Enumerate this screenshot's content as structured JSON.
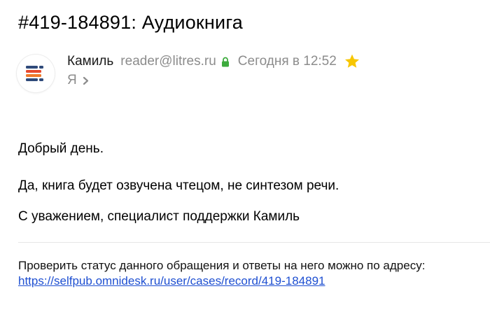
{
  "email": {
    "subject": "#419-184891: Аудиокнига",
    "sender": {
      "name": "Камиль",
      "email": "reader@litres.ru",
      "verified_icon": "lock-icon",
      "date": "Сегодня в 12:52",
      "starred": true,
      "star_icon": "star-icon"
    },
    "recipient": {
      "label": "Я",
      "expand_icon": "chevron-right-icon"
    },
    "avatar": {
      "icon": "selfpub-logo-icon",
      "colors": [
        "#2f4a7a",
        "#e84a2f",
        "#f07a2a"
      ]
    },
    "body": {
      "greeting": "Добрый день.",
      "answer": "Да, книга будет озвучена чтецом, не синтезом речи.",
      "signature": "С уважением, специалист поддержки Камиль"
    },
    "footer": {
      "note": "Проверить статус данного обращения и ответы на него можно по адресу:",
      "link_text": "https://selfpub.omnidesk.ru/user/cases/record/419-184891"
    }
  },
  "colors": {
    "link": "#1e4fd1",
    "secondary_text": "#8c8c8c",
    "lock": "#3dab3d",
    "star": "#f7c600"
  }
}
